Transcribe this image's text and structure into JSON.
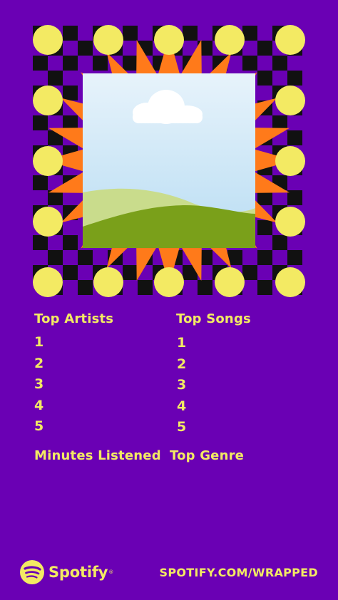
{
  "colors": {
    "background": "#6a00b4",
    "accent_yellow": "#f3ea63",
    "sun_orange": "#ff7a1a",
    "checker_black": "#111111",
    "sky": "#cfe6f7",
    "hill_light": "#c9dc8c",
    "hill_dark": "#7aa01a"
  },
  "image": {
    "name": "placeholder-landscape",
    "icon": "image-placeholder-icon"
  },
  "stats": {
    "top_artists": {
      "heading": "Top Artists",
      "ranks": [
        "1",
        "2",
        "3",
        "4",
        "5"
      ]
    },
    "top_songs": {
      "heading": "Top Songs",
      "ranks": [
        "1",
        "2",
        "3",
        "4",
        "5"
      ]
    },
    "minutes_listened": {
      "heading": "Minutes Listened"
    },
    "top_genre": {
      "heading": "Top Genre"
    }
  },
  "footer": {
    "brand": "Spotify",
    "logo_icon": "spotify-logo-icon",
    "url": "SPOTIFY.COM/WRAPPED"
  }
}
